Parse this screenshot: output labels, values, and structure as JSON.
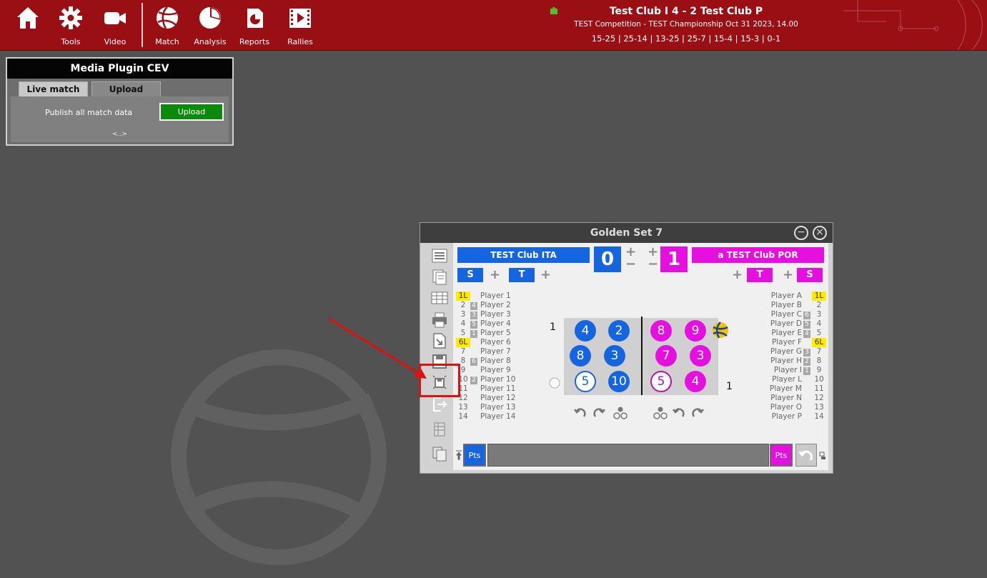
{
  "toolbar": {
    "items": [
      {
        "name": "home",
        "label": ""
      },
      {
        "name": "tools",
        "label": "Tools"
      },
      {
        "name": "video",
        "label": "Video"
      },
      {
        "name": "match",
        "label": "Match"
      },
      {
        "name": "analysis",
        "label": "Analysis"
      },
      {
        "name": "reports",
        "label": "Reports"
      },
      {
        "name": "rallies",
        "label": "Rallies"
      }
    ]
  },
  "match_header": {
    "title": "Test Club I  4 - 2  Test Club P",
    "subtitle": "TEST Competition - TEST Championship Oct 31 2023, 14.00",
    "sets": "15-25 | 25-14 | 13-25 | 25-7 | 15-4 | 15-3 | 0-1"
  },
  "media_plugin": {
    "title": "Media Plugin CEV",
    "tabs": [
      "Live match",
      "Upload"
    ],
    "publish_text": "Publish all match data",
    "upload_button": "Upload",
    "more": "<..>"
  },
  "golden_set": {
    "title": "Golden Set 7",
    "home": {
      "name": "TEST Club ITA",
      "score": "0",
      "color": "#1565e0",
      "s_label": "S",
      "t_label": "T"
    },
    "away": {
      "name": "a TEST Club POR",
      "score": "1",
      "color": "#e510e0",
      "s_label": "S",
      "t_label": "T"
    },
    "home_roster": [
      {
        "num": "1L",
        "hl": true,
        "sub": "",
        "name": "Player 1"
      },
      {
        "num": "2",
        "sub": "4",
        "name": "Player 2"
      },
      {
        "num": "3",
        "sub": "3",
        "name": "Player 3"
      },
      {
        "num": "4",
        "sub": "5",
        "name": "Player 4"
      },
      {
        "num": "5",
        "sub": "1",
        "name": "Player 5"
      },
      {
        "num": "6L",
        "hl": true,
        "sub": "",
        "name": "Player 6"
      },
      {
        "num": "7",
        "sub": "",
        "name": "Player 7"
      },
      {
        "num": "8",
        "sub": "6",
        "name": "Player 8"
      },
      {
        "num": "9",
        "sub": "",
        "name": "Player 9"
      },
      {
        "num": "10",
        "sub": "2",
        "name": "Player 10"
      },
      {
        "num": "11",
        "sub": "",
        "name": "Player 11"
      },
      {
        "num": "12",
        "sub": "",
        "name": "Player 12"
      },
      {
        "num": "13",
        "sub": "",
        "name": "Player 13"
      },
      {
        "num": "14",
        "sub": "",
        "name": "Player 14"
      }
    ],
    "away_roster": [
      {
        "name": "Player A",
        "sub": "",
        "num": "1L",
        "hl": true
      },
      {
        "name": "Player B",
        "sub": "",
        "num": "2"
      },
      {
        "name": "Player C",
        "sub": "6",
        "num": "3"
      },
      {
        "name": "Player D",
        "sub": "5",
        "num": "4"
      },
      {
        "name": "Player E",
        "sub": "4",
        "num": "5"
      },
      {
        "name": "Player F",
        "sub": "",
        "num": "6L",
        "hl": true
      },
      {
        "name": "Player G",
        "sub": "3",
        "num": "7"
      },
      {
        "name": "Player H",
        "sub": "2",
        "num": "8"
      },
      {
        "name": "Player I",
        "sub": "1",
        "num": "9"
      },
      {
        "name": "Player L",
        "sub": "",
        "num": "10"
      },
      {
        "name": "Player M",
        "sub": "",
        "num": "11"
      },
      {
        "name": "Player N",
        "sub": "",
        "num": "12"
      },
      {
        "name": "Player O",
        "sub": "",
        "num": "13"
      },
      {
        "name": "Player P",
        "sub": "",
        "num": "14"
      }
    ],
    "court": {
      "home_players": [
        "4",
        "2",
        "8",
        "3",
        "5",
        "10"
      ],
      "away_players": [
        "8",
        "9",
        "7",
        "3",
        "5",
        "4"
      ],
      "home_rotation": "1",
      "away_rotation": "1"
    },
    "pts_label": "Pts"
  }
}
